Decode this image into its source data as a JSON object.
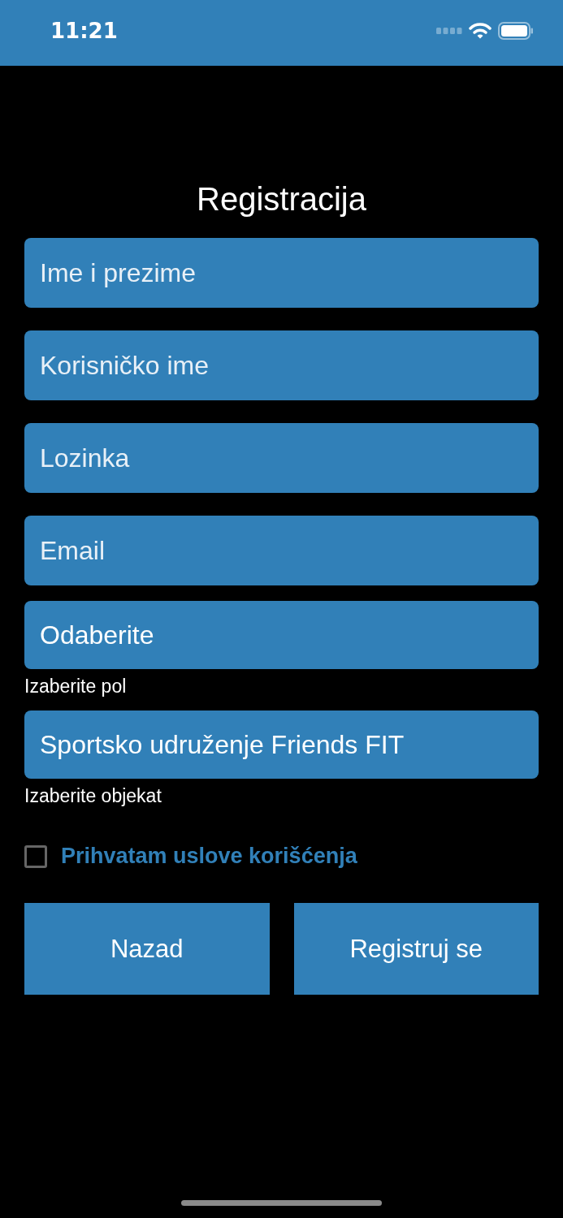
{
  "status_bar": {
    "time": "11:21"
  },
  "title": "Registracija",
  "fields": [
    {
      "kind": "input",
      "placeholder": "Ime i prezime"
    },
    {
      "kind": "input",
      "placeholder": "Korisničko ime"
    },
    {
      "kind": "input",
      "placeholder": "Lozinka"
    },
    {
      "kind": "input",
      "placeholder": "Email"
    },
    {
      "kind": "picker",
      "value": "Odaberite",
      "helper": "Izaberite pol"
    },
    {
      "kind": "picker",
      "value": "Sportsko udruženje Friends FIT",
      "helper": "Izaberite objekat"
    }
  ],
  "terms": {
    "label": "Prihvatam uslove korišćenja",
    "checked": false
  },
  "buttons": [
    "Nazad",
    "Registruj se"
  ]
}
